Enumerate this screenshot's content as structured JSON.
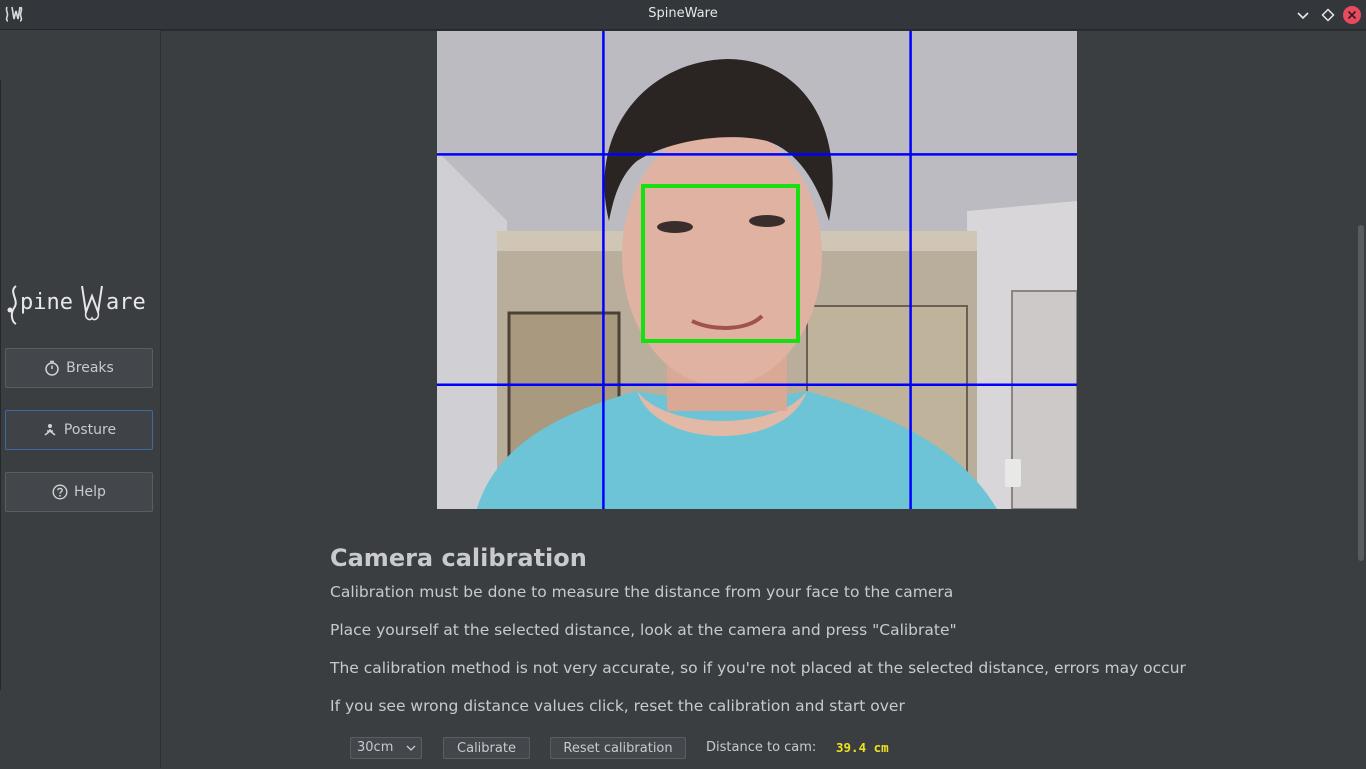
{
  "window": {
    "title": "SpineWare"
  },
  "sidebar": {
    "logo_text": "SpineWare",
    "items": [
      {
        "label": "Breaks",
        "icon": "stopwatch-icon"
      },
      {
        "label": "Posture",
        "icon": "person-icon"
      },
      {
        "label": "Help",
        "icon": "question-circle-icon"
      }
    ],
    "active": "Posture"
  },
  "camera": {
    "grid_color": "#0000ff",
    "face_box_color": "#18e010"
  },
  "calibration": {
    "heading": "Camera calibration",
    "paragraphs": [
      "Calibration must be done to measure the distance from your face to the camera",
      "Place yourself at the selected distance, look at the camera and press \"Calibrate\"",
      "The calibration method is not very accurate, so if you're not placed at the selected distance, errors may occur",
      "If you see wrong distance values click, reset the calibration and start over"
    ],
    "distance_select": "30cm",
    "calibrate_label": "Calibrate",
    "reset_label": "Reset calibration",
    "distance_label": "Distance to cam:",
    "distance_value": "39.4 cm",
    "distance_value_color": "#f0e020"
  }
}
